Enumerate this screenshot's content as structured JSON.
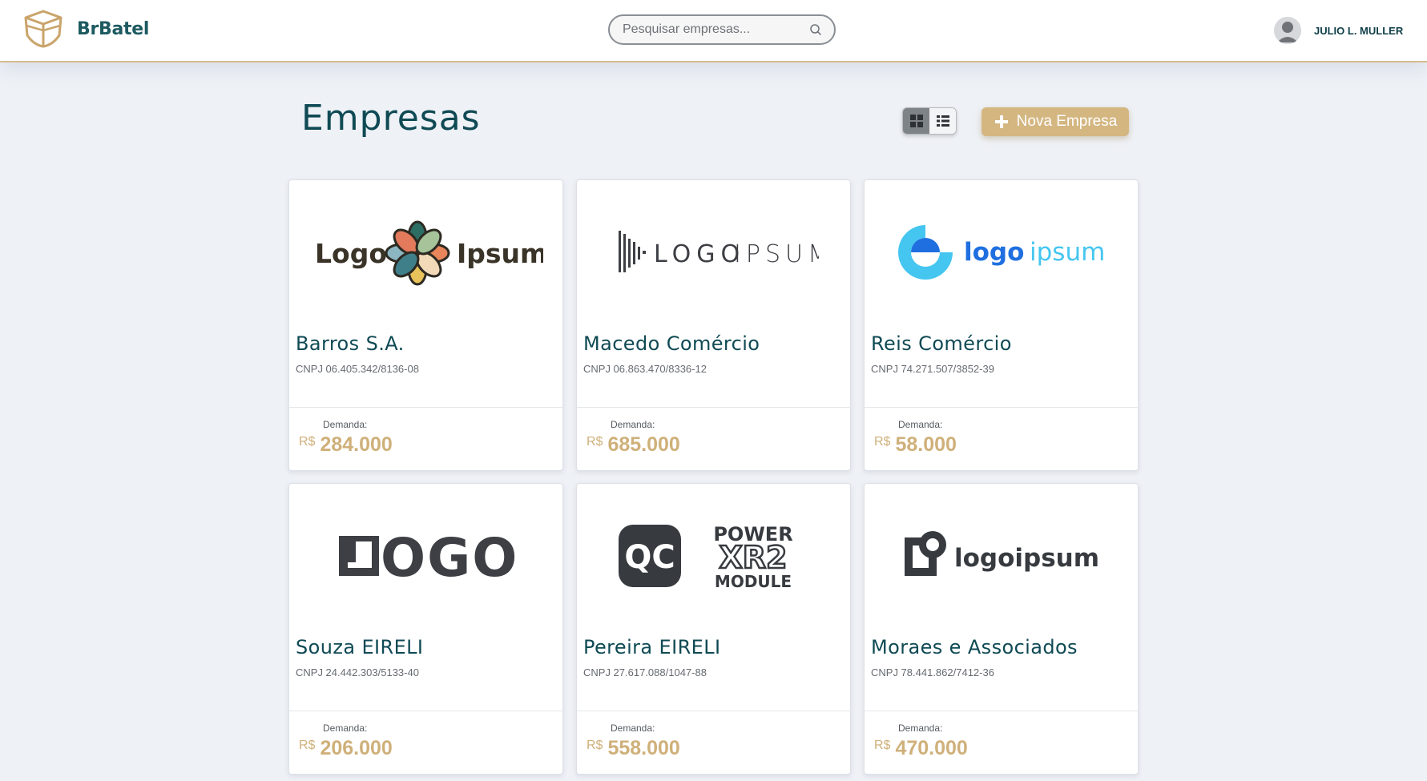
{
  "header": {
    "brand_name": "BrBatel",
    "search_placeholder": "Pesquisar empresas...",
    "user_name": "JULIO L. MULLER"
  },
  "page": {
    "title": "Empresas",
    "new_company_label": "Nova Empresa"
  },
  "companies": [
    {
      "name": "Barros S.A.",
      "cnpj": "CNPJ 06.405.342/8136-08",
      "demand_label": "Demanda:",
      "currency": "R$",
      "demand": "284.000",
      "logo": "flower-logo",
      "logo_text_1": "Logo",
      "logo_text_2": "Ipsum"
    },
    {
      "name": "Macedo Comércio",
      "cnpj": "CNPJ 06.863.470/8336-12",
      "demand_label": "Demanda:",
      "currency": "R$",
      "demand": "685.000",
      "logo": "bars-logo",
      "logo_text_1": "LOGO",
      "logo_text_2": "IPSUM"
    },
    {
      "name": "Reis Comércio",
      "cnpj": "CNPJ 74.271.507/3852-39",
      "demand_label": "Demanda:",
      "currency": "R$",
      "demand": "58.000",
      "logo": "ring-logo",
      "logo_text_1": "logo",
      "logo_text_2": "ipsum"
    },
    {
      "name": "Souza EIRELI",
      "cnpj": "CNPJ 24.442.303/5133-40",
      "demand_label": "Demanda:",
      "currency": "R$",
      "demand": "206.000",
      "logo": "logo-wordmark",
      "logo_text_1": "OGO"
    },
    {
      "name": "Pereira EIRELI",
      "cnpj": "CNPJ 27.617.088/1047-88",
      "demand_label": "Demanda:",
      "currency": "R$",
      "demand": "558.000",
      "logo": "qc-logo",
      "logo_text_1": "QC",
      "logo_text_2": "POWER",
      "logo_text_3": "XR2",
      "logo_text_4": "MODULE"
    },
    {
      "name": "Moraes e Associados",
      "cnpj": "CNPJ 78.441.862/7412-36",
      "demand_label": "Demanda:",
      "currency": "R$",
      "demand": "470.000",
      "logo": "square-logo",
      "logo_text_1": "logoipsum"
    }
  ],
  "colors": {
    "accent": "#d4b681",
    "primary": "#0f4a54",
    "background": "#eef1f6"
  },
  "icons": {
    "brand": "ship-logo-icon",
    "search": "search-icon",
    "grid_view": "grid-view-icon",
    "list_view": "list-view-icon",
    "add": "plus-icon"
  },
  "view_mode": "grid"
}
